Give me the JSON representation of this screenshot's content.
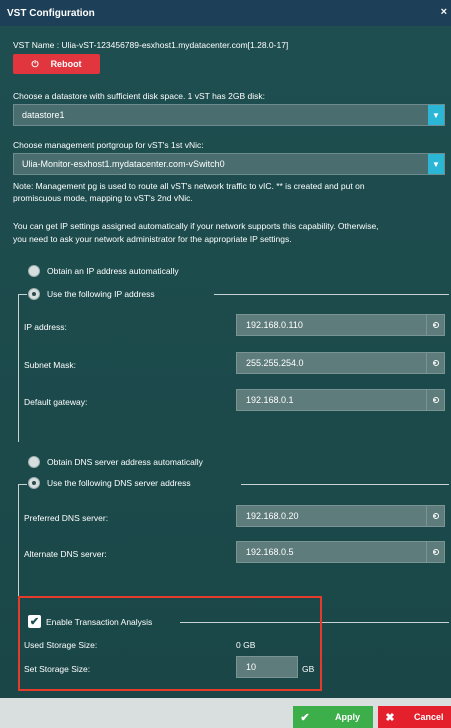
{
  "window": {
    "title": "VST Configuration",
    "close_icon": "×"
  },
  "vst": {
    "name_text": "VST Name : Ulia-vST-123456789-esxhost1.mydatacenter.com[1.28.0-17]",
    "reboot_label": "Reboot",
    "reboot_icon": "⏻"
  },
  "datastore": {
    "label": "Choose a datastore with sufficient disk space. 1 vST has 2GB disk:",
    "value": "datastore1"
  },
  "portgroup": {
    "label": "Choose management portgroup for vST's 1st vNic:",
    "value": "Ulia-Monitor-esxhost1.mydatacenter.com-vSwitch0",
    "note_line1": "Note: Management pg is used to route all vST's network traffic to vIC. ** is created and put on",
    "note_line2": "promiscuous mode, mapping to vST's 2nd vNic."
  },
  "ip_info": {
    "line1": "You can get IP settings assigned automatically if your network supports this capability. Otherwise,",
    "line2": "you need to ask your network administrator for the appropriate IP settings."
  },
  "ip": {
    "obtain_auto_label": "Obtain an IP address automatically",
    "use_following_label": "Use the following IP address",
    "address_label": "IP address:",
    "address_value": "192.168.0.110",
    "subnet_label": "Subnet Mask:",
    "subnet_value": "255.255.254.0",
    "gateway_label": "Default gateway:",
    "gateway_value": "192.168.0.1"
  },
  "dns": {
    "obtain_auto_label": "Obtain DNS server address automatically",
    "use_following_label": "Use the following DNS server address",
    "preferred_label": "Preferred DNS server:",
    "preferred_value": "192.168.0.20",
    "alternate_label": "Alternate DNS server:",
    "alternate_value": "192.168.0.5"
  },
  "transaction": {
    "enable_label": "Enable Transaction Analysis",
    "used_label": "Used Storage Size:",
    "used_value": "0 GB",
    "set_label": "Set Storage Size:",
    "set_value": "10",
    "set_unit": "GB"
  },
  "footer": {
    "apply_label": "Apply",
    "apply_icon": "✔",
    "cancel_label": "Cancel",
    "cancel_icon": "✖"
  },
  "colors": {
    "background": "#1f4b4d",
    "titlebar": "#1d3f58",
    "reboot": "#e2363e",
    "accent": "#2bb6d6",
    "apply": "#3cae4a",
    "cancel": "#e3202c",
    "highlight": "#e53b2a"
  }
}
